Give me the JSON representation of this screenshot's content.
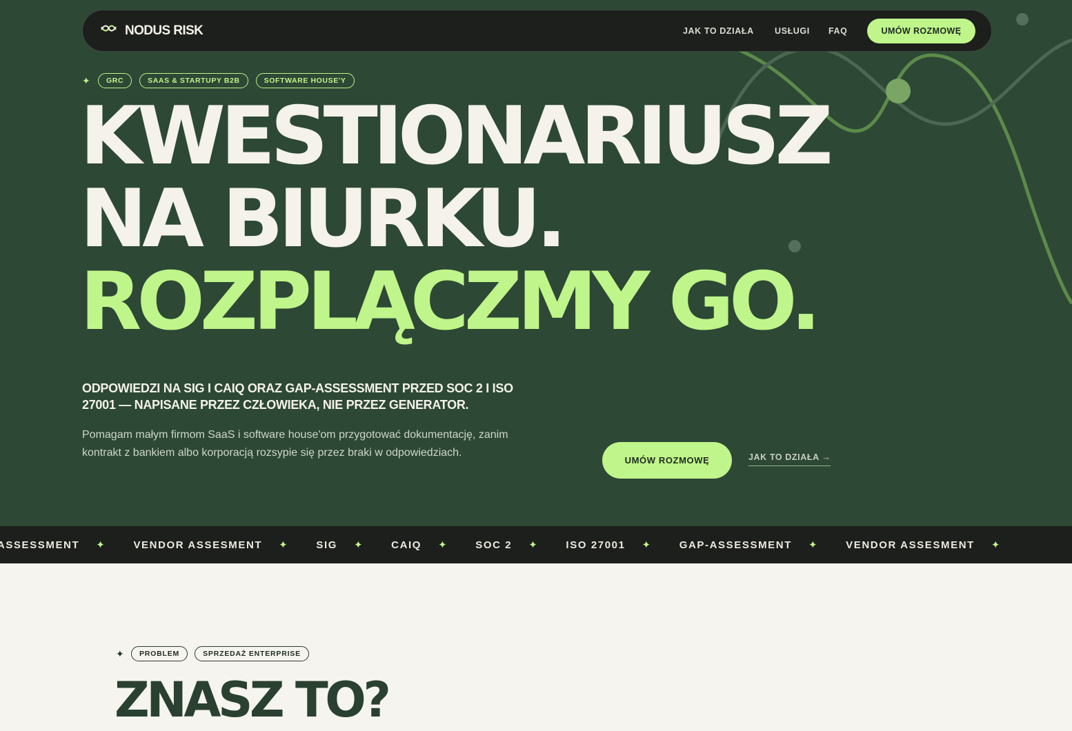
{
  "brand": {
    "name": "NODUS RISK",
    "logo_icon": "knot-logo-icon"
  },
  "nav": {
    "links": [
      "JAK TO DZIAŁA",
      "USŁUGI",
      "FAQ"
    ],
    "cta": "UMÓW ROZMOWĘ"
  },
  "hero": {
    "tags": [
      "GRC",
      "SAAS & STARTUPY B2B",
      "SOFTWARE HOUSE'Y"
    ],
    "headline_line1": "KWESTIONARIUSZ",
    "headline_line2": "NA BIURKU.",
    "headline_line3": "ROZPLĄCZMY GO.",
    "subhead": "ODPOWIEDZI NA SIG I CAIQ ORAZ GAP-ASSESSMENT PRZED SOC 2 I ISO 27001 — NAPISANE PRZEZ CZŁOWIEKA, NIE PRZEZ GENERATOR.",
    "description": "Pomagam małym firmom SaaS i software house'om przygotować dokumentację, zanim kontrakt z bankiem albo korporacją rozsypie się przez braki w odpowiedziach.",
    "cta_primary": "UMÓW ROZMOWĘ",
    "cta_secondary": "JAK TO DZIAŁA →"
  },
  "marquee": {
    "items": [
      "GAP-ASSESSMENT",
      "VENDOR ASSESMENT",
      "SIG",
      "CAIQ",
      "SOC 2",
      "ISO 27001",
      "GAP-ASSESSMENT",
      "VENDOR ASSESMENT"
    ]
  },
  "problem_section": {
    "tags": [
      "PROBLEM",
      "SPRZEDAŻ ENTERPRISE"
    ],
    "title": "ZNASZ TO?"
  },
  "colors": {
    "hero_bg": "#2d4835",
    "accent": "#bff58a",
    "dark": "#1d1f1c",
    "light_bg": "#f5f4ef"
  }
}
